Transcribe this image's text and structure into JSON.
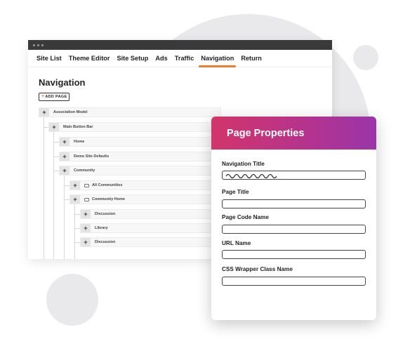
{
  "browser": {
    "nav": [
      {
        "label": "Site List"
      },
      {
        "label": "Theme Editor"
      },
      {
        "label": "Site Setup"
      },
      {
        "label": "Ads"
      },
      {
        "label": "Traffic"
      },
      {
        "label": "Navigation",
        "active": true
      },
      {
        "label": "Return"
      }
    ],
    "page_title": "Navigation",
    "add_page_label": "ADD PAGE",
    "tree": [
      {
        "label": "Association Model",
        "level": 0,
        "icon": false
      },
      {
        "label": "Main Button Bar",
        "level": 1,
        "icon": false
      },
      {
        "label": "Home",
        "level": 2,
        "icon": false
      },
      {
        "label": "Demo Site Defaults",
        "level": 2,
        "icon": false
      },
      {
        "label": "Community",
        "level": 2,
        "icon": false
      },
      {
        "label": "All Communities",
        "level": 3,
        "icon": true
      },
      {
        "label": "Community Home",
        "level": 3,
        "icon": true
      },
      {
        "label": "Discussion",
        "level": 4,
        "icon": false
      },
      {
        "label": "Library",
        "level": 4,
        "icon": false
      },
      {
        "label": "Discussion",
        "level": 4,
        "icon": false
      }
    ]
  },
  "panel": {
    "title": "Page Properties",
    "fields": [
      {
        "label": "Navigation Title",
        "value": "",
        "squiggle": true
      },
      {
        "label": "Page Title",
        "value": ""
      },
      {
        "label": "Page Code Name",
        "value": ""
      },
      {
        "label": "URL Name",
        "value": ""
      },
      {
        "label": "CSS Wrapper Class Name",
        "value": ""
      }
    ]
  },
  "colors": {
    "accent": "#f07b2b",
    "header_gradient_start": "#d2356a",
    "header_gradient_end": "#9a35a9",
    "titlebar": "#3a3a3a"
  }
}
